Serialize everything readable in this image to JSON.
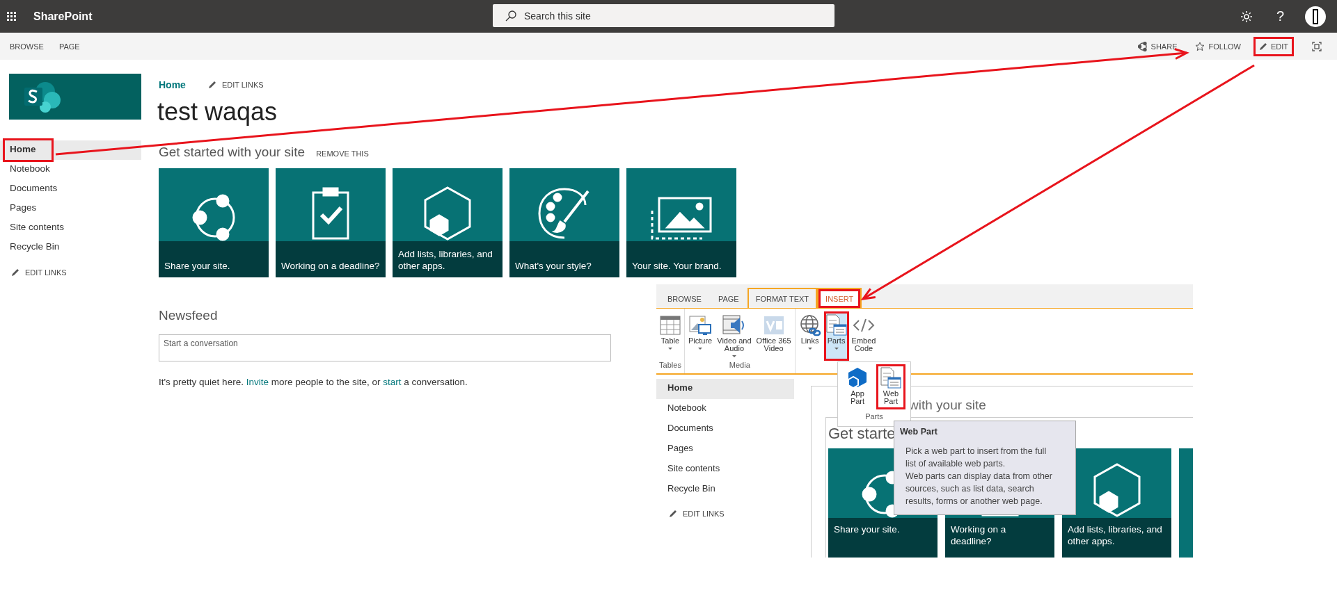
{
  "suite_bar": {
    "app_name": "SharePoint",
    "search": {
      "placeholder": "Search this site"
    },
    "help": "?"
  },
  "command_bar": {
    "tabs": [
      {
        "label": "BROWSE",
        "selected": false
      },
      {
        "label": "PAGE",
        "selected": false
      }
    ],
    "actions": [
      {
        "kind": "share",
        "label": "SHARE",
        "highlighted": false
      },
      {
        "kind": "follow",
        "label": "FOLLOW",
        "highlighted": false
      },
      {
        "kind": "edit",
        "label": "EDIT",
        "highlighted": true
      },
      {
        "kind": "focus",
        "highlighted": false
      }
    ]
  },
  "sidebar": {
    "items": [
      {
        "label": "Home",
        "selected": true,
        "highlighted": true
      },
      {
        "label": "Notebook",
        "selected": false,
        "highlighted": false
      },
      {
        "label": "Documents",
        "selected": false,
        "highlighted": false
      },
      {
        "label": "Pages",
        "selected": false,
        "highlighted": false
      },
      {
        "label": "Site contents",
        "selected": false,
        "highlighted": false
      },
      {
        "label": "Recycle Bin",
        "selected": false,
        "highlighted": false
      }
    ],
    "edit_links": "EDIT LINKS"
  },
  "breadcrumb": {
    "link": "Home",
    "edit_links": "EDIT LINKS"
  },
  "page_title": "test waqas",
  "get_started": {
    "heading": "Get started with your site",
    "remove": "REMOVE THIS",
    "tiles": [
      {
        "kind": "share",
        "caption": "Share your site."
      },
      {
        "kind": "deadline",
        "caption": "Working on a deadline?"
      },
      {
        "kind": "apps",
        "caption": "Add lists, libraries, and other apps."
      },
      {
        "kind": "style",
        "caption": "What's your style?"
      },
      {
        "kind": "brand",
        "caption": "Your site. Your brand."
      }
    ]
  },
  "newsfeed": {
    "heading": "Newsfeed",
    "input": {
      "placeholder": "Start a conversation"
    },
    "message": [
      {
        "text": "It's pretty quiet here. ",
        "link": false
      },
      {
        "text": "Invite",
        "link": true
      },
      {
        "text": " more people to the site, or ",
        "link": false
      },
      {
        "text": "start",
        "link": true
      },
      {
        "text": " a conversation.",
        "link": false
      }
    ]
  },
  "inset": {
    "ribbon_tabs": [
      {
        "label": "BROWSE",
        "selected": false,
        "contextual": false,
        "highlighted": false
      },
      {
        "label": "PAGE",
        "selected": false,
        "contextual": false,
        "highlighted": false
      },
      {
        "label": "FORMAT TEXT",
        "selected": false,
        "contextual": true,
        "highlighted": false
      },
      {
        "label": "INSERT",
        "selected": true,
        "contextual": true,
        "highlighted": true
      }
    ],
    "groups": [
      {
        "label": "Tables",
        "buttons": [
          {
            "kind": "table",
            "lines": [
              "Table"
            ],
            "dropdown": true,
            "selected": false,
            "highlighted": false
          }
        ]
      },
      {
        "label": "Media",
        "buttons": [
          {
            "kind": "picture",
            "lines": [
              "Picture"
            ],
            "dropdown": true,
            "selected": false,
            "highlighted": false
          },
          {
            "kind": "video",
            "lines": [
              "Video and",
              "Audio"
            ],
            "dropdown": true,
            "selected": false,
            "highlighted": false
          },
          {
            "kind": "office-video",
            "lines": [
              "Office 365",
              "Video"
            ],
            "dropdown": false,
            "selected": false,
            "highlighted": false
          }
        ]
      },
      {
        "buttons": [
          {
            "kind": "links",
            "lines": [
              "Links"
            ],
            "dropdown": true,
            "selected": false,
            "highlighted": false
          },
          {
            "kind": "parts",
            "lines": [
              "Parts"
            ],
            "dropdown": true,
            "selected": true,
            "highlighted": true
          },
          {
            "kind": "embed",
            "lines": [
              "Embed",
              "Code"
            ],
            "dropdown": false,
            "selected": false,
            "highlighted": false
          }
        ]
      }
    ],
    "parts_menu": {
      "items": [
        {
          "kind": "app-part",
          "lines": [
            "App",
            "Part"
          ],
          "highlighted": false
        },
        {
          "kind": "web-part",
          "lines": [
            "Web",
            "Part"
          ],
          "highlighted": true
        }
      ],
      "label": "Parts"
    },
    "tooltip": {
      "title": "Web Part",
      "paragraphs": [
        "Pick a web part to insert from the full list of available web parts.",
        "Web parts can display data from other sources, such as list data, search results, forms or another web page."
      ]
    },
    "sidebar": {
      "items": [
        {
          "label": "Home",
          "selected": true,
          "highlighted": false
        },
        {
          "label": "Notebook",
          "selected": false,
          "highlighted": false
        },
        {
          "label": "Documents",
          "selected": false,
          "highlighted": false
        },
        {
          "label": "Pages",
          "selected": false,
          "highlighted": false
        },
        {
          "label": "Site contents",
          "selected": false,
          "highlighted": false
        },
        {
          "label": "Recycle Bin",
          "selected": false,
          "highlighted": false
        }
      ],
      "edit_links": "EDIT LINKS"
    },
    "partial_heading": "with your site",
    "heading": "Get starte",
    "tiles": [
      {
        "kind": "share",
        "caption": "Share your site."
      },
      {
        "kind": "deadline",
        "caption": "Working on a deadline?"
      },
      {
        "kind": "apps",
        "caption": "Add lists, libraries, and other apps."
      }
    ]
  }
}
